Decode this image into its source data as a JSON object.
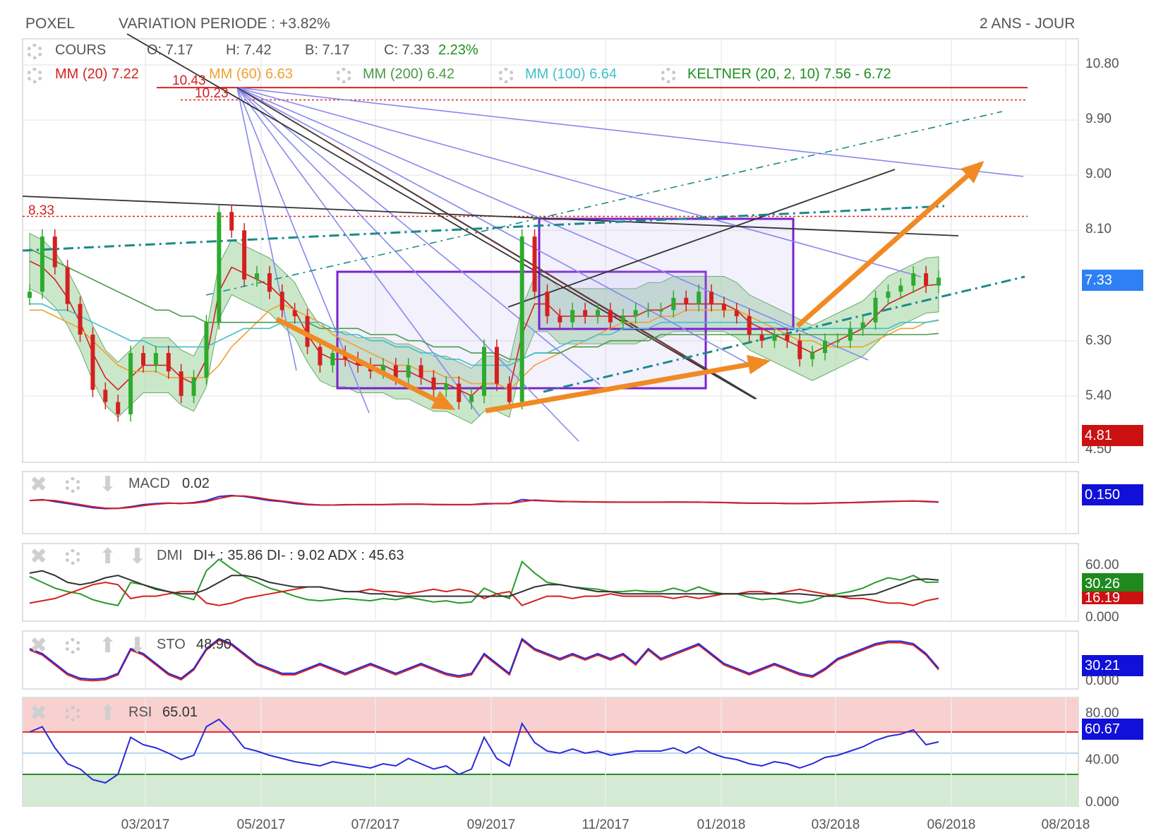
{
  "header": {
    "symbol": "POXEL",
    "variation": "VARIATION PERIODE : +3.82%",
    "period": "2 ANS - JOUR"
  },
  "legend": {
    "cours_label": "COURS",
    "o": "O: 7.17",
    "h": "H: 7.42",
    "b": "B: 7.17",
    "c": "C: 7.33",
    "c_change": "2.23%",
    "mm20": "MM (20)  7.22",
    "mm60": "MM (60)  6.63",
    "mm200": "MM (200)  6.42",
    "mm100": "MM (100)  6.64",
    "keltner": "KELTNER (20, 2, 10)  7.56 - 6.72"
  },
  "annotations": {
    "high_level": "10.43",
    "second_level": "10.23",
    "resistance": "8.33"
  },
  "badges": {
    "last_price": "7.33",
    "low_price": "4.81",
    "macd": "0.150",
    "dmi_plus": "30.26",
    "dmi_minus": "16.19",
    "sto": "30.21",
    "rsi": "60.67"
  },
  "indicators": {
    "macd": {
      "label": "MACD",
      "value": "0.02"
    },
    "dmi": {
      "label": "DMI",
      "value": "DI+ : 35.86 DI- : 9.02 ADX : 45.63"
    },
    "sto": {
      "label": "STO",
      "value": "48.90"
    },
    "rsi": {
      "label": "RSI",
      "value": "65.01"
    }
  },
  "axes": {
    "price_ticks": [
      "10.80",
      "9.90",
      "9.00",
      "8.10",
      "6.30",
      "5.40",
      "4.50"
    ],
    "dmi_ticks": [
      "60.00",
      "0.000"
    ],
    "sto_ticks": [
      "0.000"
    ],
    "rsi_ticks": [
      "80.00",
      "40.00",
      "0.000"
    ],
    "x_ticks": [
      "03/2017",
      "05/2017",
      "07/2017",
      "09/2017",
      "11/2017",
      "01/2018",
      "03/2018",
      "06/2018",
      "08/2018"
    ]
  },
  "colors": {
    "up": "#2eaa2e",
    "down": "#d42020",
    "mm20": "#d42020",
    "mm60": "#f0a030",
    "mm200": "#4a9a4a",
    "mm100": "#40c0c8",
    "keltner_fill": "#9ed49e",
    "fan": "#8888ee",
    "box": "#7a22cc",
    "arrow": "#f08a24",
    "trend": "#1a8a8a"
  },
  "chart_data": [
    {
      "type": "line",
      "title": "POXEL",
      "note": "candlestick price chart, daily, 2 years",
      "ylim": [
        4.5,
        10.8
      ],
      "x": [
        "2017-01-09",
        "2017-01-16",
        "2017-01-23",
        "2017-01-30",
        "2017-02-06",
        "2017-02-13",
        "2017-02-20",
        "2017-02-27",
        "2017-03-06",
        "2017-03-13",
        "2017-03-20",
        "2017-03-27",
        "2017-04-03",
        "2017-04-10",
        "2017-04-18",
        "2017-04-24",
        "2017-05-01",
        "2017-05-08",
        "2017-05-15",
        "2017-05-22",
        "2017-05-29",
        "2017-06-05",
        "2017-06-12",
        "2017-06-19",
        "2017-06-26",
        "2017-07-03",
        "2017-07-10",
        "2017-07-17",
        "2017-07-24",
        "2017-07-31",
        "2017-08-07",
        "2017-08-14",
        "2017-08-21",
        "2017-08-28",
        "2017-09-04",
        "2017-09-11",
        "2017-09-18",
        "2017-09-25",
        "2017-10-02",
        "2017-10-09",
        "2017-10-16",
        "2017-10-23",
        "2017-10-30",
        "2017-11-06",
        "2017-11-13",
        "2017-11-20",
        "2017-11-27",
        "2017-12-04",
        "2017-12-11",
        "2017-12-18",
        "2017-12-26",
        "2018-01-02",
        "2018-01-08",
        "2018-01-15",
        "2018-01-22",
        "2018-01-29",
        "2018-02-05",
        "2018-02-12",
        "2018-02-19",
        "2018-02-26",
        "2018-03-05",
        "2018-03-12",
        "2018-03-19",
        "2018-03-26",
        "2018-04-03",
        "2018-04-09",
        "2018-04-16",
        "2018-04-23",
        "2018-04-30",
        "2018-05-07",
        "2018-05-14",
        "2018-05-22",
        "2018-05-28"
      ],
      "series": [
        {
          "name": "COURS",
          "values": [
            7.1,
            8.0,
            7.5,
            6.9,
            6.4,
            5.5,
            5.3,
            5.1,
            6.1,
            5.9,
            6.1,
            5.8,
            5.4,
            5.7,
            6.6,
            8.4,
            8.1,
            7.3,
            7.4,
            7.1,
            6.8,
            6.7,
            6.2,
            5.9,
            6.1,
            6.0,
            5.9,
            5.8,
            5.9,
            5.7,
            5.9,
            5.7,
            5.5,
            5.6,
            5.3,
            5.4,
            6.2,
            5.6,
            5.3,
            8.0,
            7.1,
            6.7,
            6.6,
            6.8,
            6.7,
            6.8,
            6.6,
            6.7,
            6.8,
            6.8,
            6.8,
            7.0,
            6.9,
            7.1,
            6.9,
            6.8,
            6.7,
            6.4,
            6.3,
            6.4,
            6.3,
            6.0,
            6.1,
            6.3,
            6.3,
            6.5,
            6.6,
            7.0,
            7.1,
            7.2,
            7.4,
            7.2,
            7.33
          ]
        },
        {
          "name": "MM (20)",
          "values": [
            7.6,
            7.5,
            7.3,
            7.0,
            6.6,
            6.1,
            5.7,
            5.5,
            5.7,
            5.9,
            5.9,
            5.9,
            5.7,
            5.6,
            6.0,
            7.1,
            7.5,
            7.4,
            7.3,
            7.2,
            7.0,
            6.8,
            6.4,
            6.1,
            6.0,
            6.0,
            5.9,
            5.9,
            5.9,
            5.8,
            5.8,
            5.7,
            5.6,
            5.6,
            5.5,
            5.4,
            5.6,
            5.6,
            5.5,
            6.4,
            6.9,
            6.9,
            6.7,
            6.7,
            6.7,
            6.7,
            6.7,
            6.7,
            6.7,
            6.8,
            6.8,
            6.9,
            6.9,
            6.9,
            6.9,
            6.9,
            6.8,
            6.6,
            6.5,
            6.4,
            6.3,
            6.2,
            6.1,
            6.2,
            6.3,
            6.4,
            6.5,
            6.7,
            6.9,
            7.0,
            7.1,
            7.2,
            7.22
          ]
        },
        {
          "name": "MM (60)",
          "values": [
            6.8,
            6.8,
            6.7,
            6.6,
            6.5,
            6.3,
            6.1,
            5.9,
            5.8,
            5.8,
            5.8,
            5.7,
            5.7,
            5.7,
            5.7,
            5.9,
            6.2,
            6.4,
            6.6,
            6.8,
            6.9,
            6.8,
            6.7,
            6.6,
            6.4,
            6.3,
            6.2,
            6.1,
            6.0,
            5.9,
            5.9,
            5.8,
            5.8,
            5.7,
            5.7,
            5.6,
            5.6,
            5.6,
            5.5,
            5.7,
            5.9,
            6.0,
            6.1,
            6.2,
            6.3,
            6.4,
            6.5,
            6.6,
            6.6,
            6.6,
            6.7,
            6.7,
            6.8,
            6.8,
            6.8,
            6.8,
            6.8,
            6.7,
            6.6,
            6.5,
            6.4,
            6.3,
            6.3,
            6.2,
            6.2,
            6.2,
            6.2,
            6.3,
            6.4,
            6.5,
            6.5,
            6.6,
            6.63
          ]
        },
        {
          "name": "MM (200)",
          "values": [
            7.8,
            7.7,
            7.6,
            7.5,
            7.4,
            7.3,
            7.2,
            7.1,
            7.0,
            6.9,
            6.8,
            6.8,
            6.7,
            6.7,
            6.6,
            6.6,
            6.6,
            6.6,
            6.6,
            6.6,
            6.6,
            6.6,
            6.6,
            6.5,
            6.5,
            6.5,
            6.5,
            6.4,
            6.4,
            6.4,
            6.3,
            6.3,
            6.2,
            6.2,
            6.2,
            6.1,
            6.1,
            6.1,
            6.0,
            6.0,
            6.1,
            6.1,
            6.1,
            6.2,
            6.2,
            6.2,
            6.3,
            6.3,
            6.3,
            6.3,
            6.4,
            6.4,
            6.4,
            6.4,
            6.4,
            6.4,
            6.4,
            6.4,
            6.4,
            6.4,
            6.4,
            6.4,
            6.4,
            6.4,
            6.4,
            6.4,
            6.4,
            6.4,
            6.4,
            6.4,
            6.4,
            6.4,
            6.42
          ]
        },
        {
          "name": "MM (100)",
          "values": [
            6.9,
            6.9,
            6.8,
            6.8,
            6.7,
            6.6,
            6.5,
            6.4,
            6.3,
            6.3,
            6.2,
            6.2,
            6.2,
            6.2,
            6.2,
            6.3,
            6.4,
            6.5,
            6.5,
            6.5,
            6.6,
            6.6,
            6.6,
            6.6,
            6.5,
            6.4,
            6.4,
            6.3,
            6.3,
            6.2,
            6.2,
            6.1,
            6.1,
            6.0,
            6.0,
            5.9,
            5.9,
            5.9,
            5.9,
            6.0,
            6.1,
            6.1,
            6.2,
            6.3,
            6.3,
            6.4,
            6.4,
            6.5,
            6.5,
            6.5,
            6.6,
            6.6,
            6.6,
            6.6,
            6.6,
            6.6,
            6.6,
            6.6,
            6.6,
            6.6,
            6.5,
            6.5,
            6.5,
            6.5,
            6.5,
            6.5,
            6.5,
            6.5,
            6.5,
            6.6,
            6.6,
            6.6,
            6.64
          ]
        }
      ]
    },
    {
      "type": "line",
      "title": "MACD",
      "ylim": [
        -0.6,
        0.6
      ],
      "series": [
        {
          "name": "MACD",
          "values": [
            0.1,
            0.15,
            0.05,
            -0.05,
            -0.15,
            -0.25,
            -0.3,
            -0.28,
            -0.2,
            -0.1,
            -0.05,
            -0.02,
            -0.05,
            0.0,
            0.1,
            0.3,
            0.35,
            0.3,
            0.2,
            0.1,
            0.05,
            -0.05,
            -0.1,
            -0.12,
            -0.12,
            -0.1,
            -0.1,
            -0.1,
            -0.1,
            -0.08,
            -0.08,
            -0.08,
            -0.1,
            -0.1,
            -0.1,
            -0.1,
            -0.05,
            -0.05,
            -0.05,
            0.15,
            0.1,
            0.08,
            0.05,
            0.05,
            0.03,
            0.03,
            0.02,
            0.02,
            0.02,
            0.02,
            0.02,
            0.03,
            0.02,
            0.02,
            0.01,
            0.0,
            -0.02,
            -0.03,
            -0.03,
            -0.03,
            -0.05,
            -0.05,
            -0.04,
            -0.02,
            -0.01,
            0.0,
            0.02,
            0.04,
            0.06,
            0.07,
            0.08,
            0.05,
            0.02
          ]
        }
      ]
    },
    {
      "type": "line",
      "title": "DMI",
      "ylim": [
        0,
        60
      ],
      "series": [
        {
          "name": "DI+",
          "values": [
            35,
            30,
            25,
            22,
            20,
            15,
            12,
            10,
            30,
            28,
            25,
            22,
            18,
            15,
            40,
            50,
            42,
            35,
            30,
            25,
            22,
            18,
            15,
            14,
            15,
            16,
            15,
            14,
            16,
            15,
            17,
            15,
            13,
            14,
            12,
            13,
            25,
            20,
            16,
            48,
            38,
            30,
            28,
            26,
            25,
            24,
            22,
            22,
            23,
            22,
            22,
            25,
            22,
            26,
            22,
            20,
            20,
            17,
            15,
            16,
            14,
            12,
            14,
            18,
            20,
            22,
            25,
            30,
            34,
            32,
            36,
            30,
            30.26
          ]
        },
        {
          "name": "DI-",
          "values": [
            12,
            14,
            16,
            20,
            24,
            28,
            30,
            28,
            16,
            18,
            18,
            20,
            22,
            22,
            12,
            10,
            12,
            16,
            18,
            20,
            22,
            24,
            26,
            26,
            24,
            22,
            22,
            24,
            22,
            22,
            20,
            22,
            24,
            22,
            24,
            22,
            16,
            20,
            22,
            10,
            14,
            18,
            18,
            16,
            18,
            18,
            20,
            18,
            18,
            18,
            18,
            16,
            18,
            16,
            18,
            20,
            20,
            22,
            22,
            20,
            22,
            24,
            22,
            20,
            18,
            16,
            16,
            14,
            12,
            12,
            10,
            14,
            16.19
          ]
        },
        {
          "name": "ADX",
          "values": [
            38,
            40,
            36,
            30,
            28,
            30,
            34,
            36,
            32,
            28,
            24,
            22,
            20,
            20,
            24,
            30,
            36,
            36,
            34,
            30,
            28,
            26,
            26,
            26,
            24,
            22,
            22,
            20,
            20,
            18,
            18,
            18,
            18,
            18,
            18,
            18,
            18,
            18,
            18,
            22,
            26,
            28,
            28,
            26,
            24,
            22,
            22,
            20,
            20,
            20,
            20,
            20,
            20,
            20,
            20,
            20,
            20,
            20,
            20,
            20,
            20,
            20,
            19,
            18,
            18,
            18,
            19,
            20,
            24,
            28,
            32,
            33,
            32
          ]
        }
      ]
    },
    {
      "type": "line",
      "title": "STO",
      "ylim": [
        0,
        100
      ],
      "series": [
        {
          "name": "STO",
          "values": [
            70,
            60,
            40,
            20,
            10,
            8,
            10,
            20,
            70,
            60,
            40,
            20,
            10,
            30,
            70,
            90,
            80,
            60,
            40,
            30,
            20,
            20,
            30,
            40,
            30,
            20,
            30,
            40,
            30,
            20,
            30,
            40,
            30,
            20,
            15,
            20,
            60,
            40,
            20,
            90,
            70,
            60,
            50,
            60,
            50,
            60,
            50,
            60,
            40,
            70,
            50,
            60,
            70,
            80,
            60,
            40,
            30,
            20,
            30,
            40,
            30,
            20,
            15,
            30,
            50,
            60,
            70,
            80,
            85,
            85,
            80,
            60,
            30.21
          ]
        }
      ]
    },
    {
      "type": "line",
      "title": "RSI",
      "ylim": [
        0,
        100
      ],
      "series": [
        {
          "name": "RSI",
          "values": [
            70,
            75,
            55,
            40,
            35,
            25,
            22,
            30,
            65,
            58,
            55,
            50,
            44,
            48,
            75,
            82,
            70,
            55,
            52,
            48,
            45,
            42,
            40,
            38,
            42,
            40,
            38,
            36,
            40,
            38,
            45,
            40,
            35,
            38,
            30,
            35,
            65,
            45,
            38,
            78,
            60,
            52,
            50,
            54,
            50,
            52,
            48,
            50,
            52,
            52,
            52,
            55,
            50,
            56,
            50,
            46,
            44,
            40,
            38,
            42,
            40,
            36,
            40,
            46,
            48,
            52,
            56,
            62,
            66,
            68,
            72,
            58,
            60.67
          ]
        }
      ]
    }
  ]
}
